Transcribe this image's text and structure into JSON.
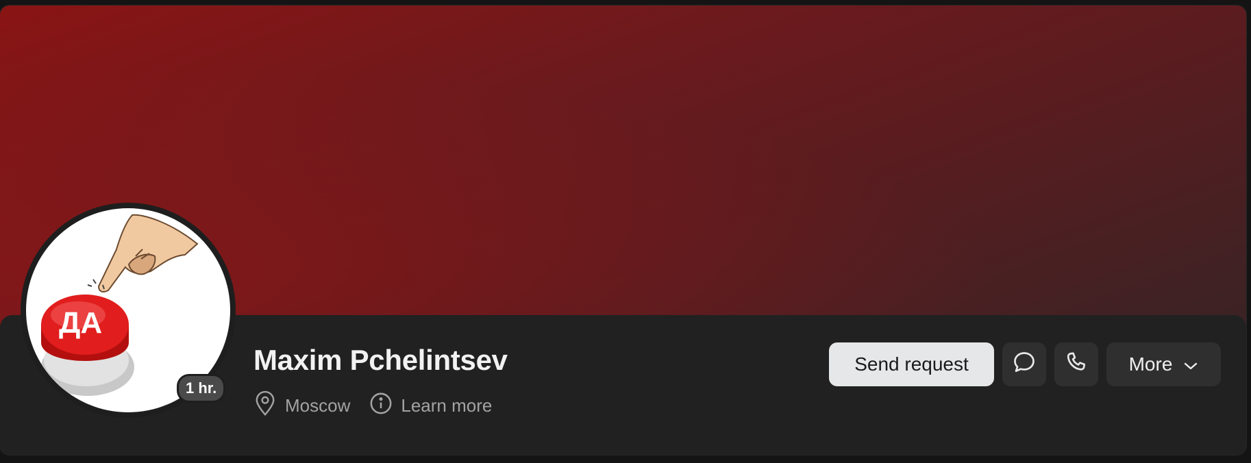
{
  "profile": {
    "name": "Maxim Pchelintsev",
    "location": "Moscow",
    "learn_more": "Learn more",
    "last_seen_badge": "1 hr.",
    "avatar_text": "ДА"
  },
  "actions": {
    "send_request": "Send request",
    "more": "More"
  },
  "icons": {
    "location": "location-pin-icon",
    "info": "info-icon",
    "message": "message-bubble-icon",
    "call": "phone-icon",
    "more_chevron": "chevron-down-icon"
  },
  "colors": {
    "cover_primary": "#8a1414",
    "cover_secondary": "#3a2325",
    "panel_bg": "#212121",
    "primary_button_bg": "#e6e7e9",
    "secondary_button_bg": "#2f2f2f",
    "muted_text": "#a3a3a3"
  }
}
